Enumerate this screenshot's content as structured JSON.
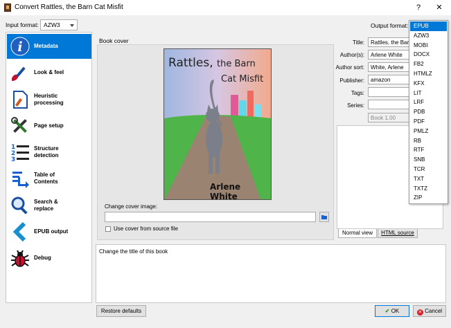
{
  "window": {
    "title": "Convert Rattles, the Barn Cat Misfit",
    "help_label": "?",
    "close_label": "✕"
  },
  "input_format": {
    "label": "Input format:",
    "value": "AZW3"
  },
  "output_format": {
    "label": "Output format:",
    "options": [
      "EPUB",
      "AZW3",
      "MOBI",
      "DOCX",
      "FB2",
      "HTMLZ",
      "KFX",
      "LIT",
      "LRF",
      "PDB",
      "PDF",
      "PMLZ",
      "RB",
      "RTF",
      "SNB",
      "TCR",
      "TXT",
      "TXTZ",
      "ZIP"
    ],
    "selected": "EPUB"
  },
  "sidebar": {
    "items": [
      {
        "label": "Metadata",
        "icon": "info-icon"
      },
      {
        "label": "Look & feel",
        "icon": "paintbrush-icon"
      },
      {
        "label": "Heuristic\nprocessing",
        "icon": "heuristics-icon"
      },
      {
        "label": "Page setup",
        "icon": "page-setup-icon"
      },
      {
        "label": "Structure\ndetection",
        "icon": "structure-icon"
      },
      {
        "label": "Table of\nContents",
        "icon": "toc-icon"
      },
      {
        "label": "Search &\nreplace",
        "icon": "search-icon"
      },
      {
        "label": "EPUB output",
        "icon": "back-arrow-icon"
      },
      {
        "label": "Debug",
        "icon": "bug-icon"
      }
    ]
  },
  "book_cover": {
    "heading": "Book cover",
    "cover_title_line1": "Rattles,",
    "cover_title_line1b": "the Barn",
    "cover_title_line2": "Cat Misfit",
    "cover_author": "Arlene White",
    "change_label": "Change cover image:",
    "change_value": "",
    "use_source_label": "Use cover from source file"
  },
  "metadata": {
    "title_label": "Title:",
    "title_value": "Rattles, the Barn",
    "authors_label": "Author(s):",
    "authors_value": "Arlene White",
    "author_sort_label": "Author sort:",
    "author_sort_value": "White, Arlene",
    "publisher_label": "Publisher:",
    "publisher_value": "amazon",
    "tags_label": "Tags:",
    "tags_value": "",
    "series_label": "Series:",
    "series_value": "",
    "series_index": "Book 1.00"
  },
  "comments": {
    "tab_normal": "Normal view",
    "tab_html": "HTML source"
  },
  "help_text": "Change the title of this book",
  "buttons": {
    "restore": "Restore defaults",
    "ok": "OK",
    "cancel": "Cancel"
  },
  "colors": {
    "accent": "#0078d7"
  }
}
